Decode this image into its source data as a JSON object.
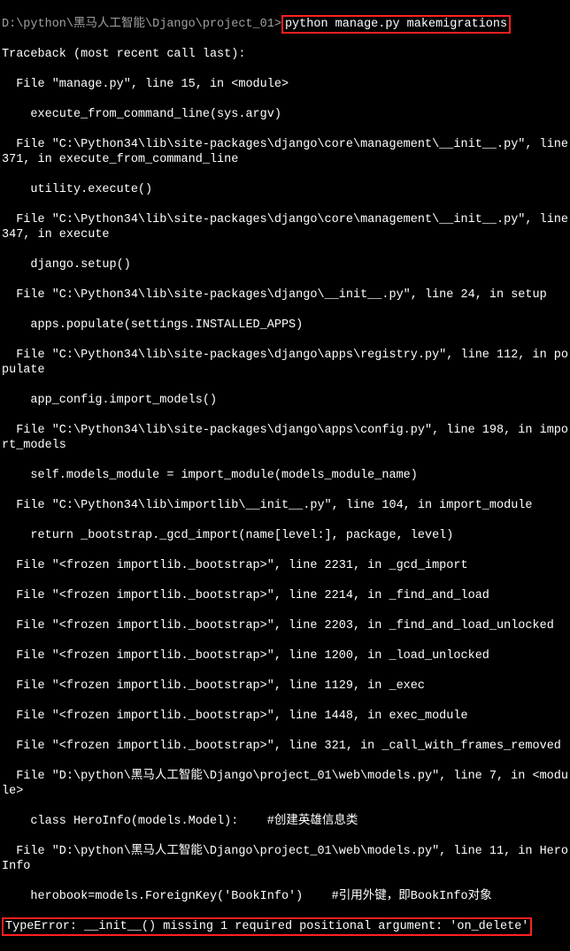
{
  "prompt_path": "D:\\python\\黑马人工智能\\Django\\project_01>",
  "prompt_cmd": "python manage.py makemigrations",
  "lines": {
    "l0": "Traceback (most recent call last):",
    "l1": "  File \"manage.py\", line 15, in <module>",
    "l2": "    execute_from_command_line(sys.argv)",
    "l3": "  File \"C:\\Python34\\lib\\site-packages\\django\\core\\management\\__init__.py\", line 371, in execute_from_command_line",
    "l4": "    utility.execute()",
    "l5": "  File \"C:\\Python34\\lib\\site-packages\\django\\core\\management\\__init__.py\", line 347, in execute",
    "l6": "    django.setup()",
    "l7": "  File \"C:\\Python34\\lib\\site-packages\\django\\__init__.py\", line 24, in setup",
    "l8": "    apps.populate(settings.INSTALLED_APPS)",
    "l9": "  File \"C:\\Python34\\lib\\site-packages\\django\\apps\\registry.py\", line 112, in populate",
    "l10": "    app_config.import_models()",
    "l11": "  File \"C:\\Python34\\lib\\site-packages\\django\\apps\\config.py\", line 198, in import_models",
    "l12": "    self.models_module = import_module(models_module_name)",
    "l13": "  File \"C:\\Python34\\lib\\importlib\\__init__.py\", line 104, in import_module",
    "l14": "    return _bootstrap._gcd_import(name[level:], package, level)",
    "l15": "  File \"<frozen importlib._bootstrap>\", line 2231, in _gcd_import",
    "l16": "  File \"<frozen importlib._bootstrap>\", line 2214, in _find_and_load",
    "l17": "  File \"<frozen importlib._bootstrap>\", line 2203, in _find_and_load_unlocked",
    "l18": "  File \"<frozen importlib._bootstrap>\", line 1200, in _load_unlocked",
    "l19": "  File \"<frozen importlib._bootstrap>\", line 1129, in _exec",
    "l20": "  File \"<frozen importlib._bootstrap>\", line 1448, in exec_module",
    "l21": "  File \"<frozen importlib._bootstrap>\", line 321, in _call_with_frames_removed",
    "l22": "  File \"D:\\python\\黑马人工智能\\Django\\project_01\\web\\models.py\", line 7, in <module>",
    "l23": "    class HeroInfo(models.Model):    #创建英雄信息类",
    "l24": "  File \"D:\\python\\黑马人工智能\\Django\\project_01\\web\\models.py\", line 11, in HeroInfo",
    "l25": "    herobook=models.ForeignKey('BookInfo')    #引用外键，即BookInfo对象"
  },
  "error_line": "TypeError: __init__() missing 1 required positional argument: 'on_delete'"
}
